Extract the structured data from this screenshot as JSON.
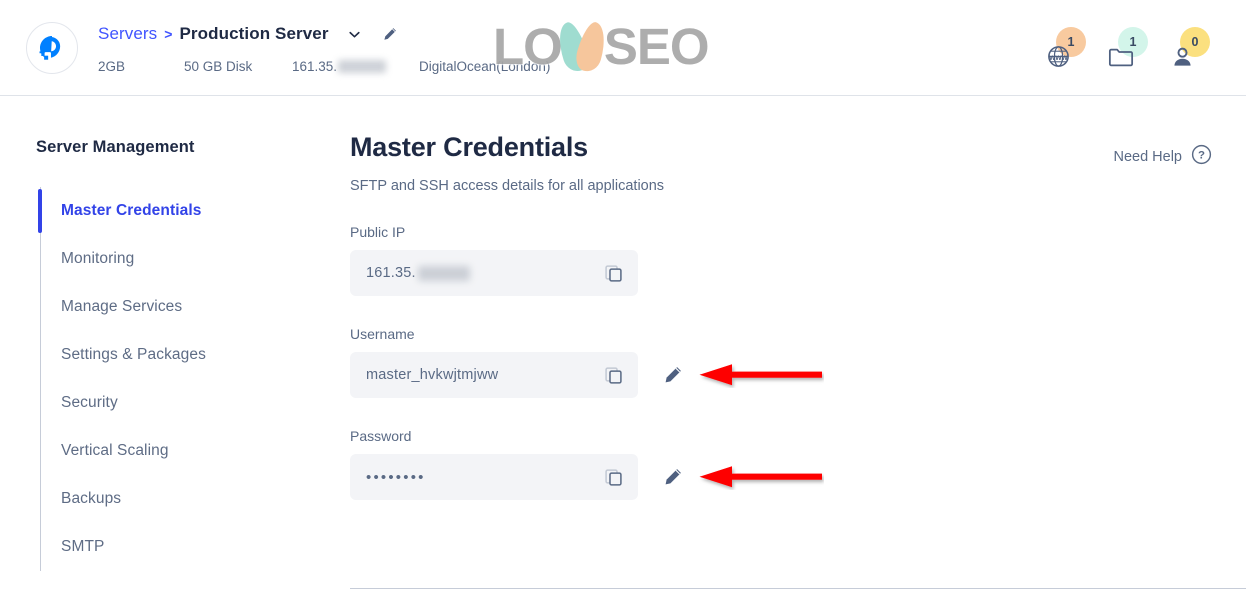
{
  "header": {
    "logo_icon": "digitalocean-logo",
    "breadcrumb": {
      "parent": "Servers",
      "separator": ">",
      "current": "Production Server",
      "chevron_icon": "chevron-down-icon",
      "edit_icon": "pencil-icon"
    },
    "meta": {
      "ram": "2GB",
      "disk": "50 GB Disk",
      "ip": "161.35.",
      "provider": "DigitalOcean(London)"
    },
    "stats": [
      {
        "icon": "www-globe-icon",
        "count": "1",
        "badge_color": "#f8ca9f"
      },
      {
        "icon": "folder-icon",
        "count": "1",
        "badge_color": "#d3f5ea"
      },
      {
        "icon": "user-icon",
        "count": "0",
        "badge_color": "#fbe07f"
      }
    ]
  },
  "watermark": {
    "left_text": "LO",
    "right_text": "SEO",
    "leaf_left_color": "#9fdcd0",
    "leaf_right_color": "#f6c69c"
  },
  "sidebar": {
    "title": "Server Management",
    "items": [
      {
        "label": "Master Credentials",
        "active": true
      },
      {
        "label": "Monitoring",
        "active": false
      },
      {
        "label": "Manage Services",
        "active": false
      },
      {
        "label": "Settings & Packages",
        "active": false
      },
      {
        "label": "Security",
        "active": false
      },
      {
        "label": "Vertical Scaling",
        "active": false
      },
      {
        "label": "Backups",
        "active": false
      },
      {
        "label": "SMTP",
        "active": false
      }
    ],
    "active_color": "#3243e8"
  },
  "main": {
    "title": "Master Credentials",
    "subtitle": "SFTP and SSH access details for all applications",
    "need_help": {
      "label": "Need Help",
      "icon": "question-circle-icon"
    },
    "fields": [
      {
        "label": "Public IP",
        "value": "161.35.",
        "redacted": true,
        "masked": false,
        "copy_icon": "copy-icon",
        "has_edit": false,
        "has_arrow": false
      },
      {
        "label": "Username",
        "value": "master_hvkwjtmjww",
        "redacted": false,
        "masked": false,
        "copy_icon": "copy-icon",
        "has_edit": true,
        "edit_icon": "pencil-icon",
        "has_arrow": true
      },
      {
        "label": "Password",
        "value": "••••••••",
        "redacted": false,
        "masked": true,
        "copy_icon": "copy-icon",
        "has_edit": true,
        "edit_icon": "pencil-icon",
        "has_arrow": true
      }
    ]
  },
  "annotation": {
    "arrow_color": "#fe0000",
    "arrow_direction": "left",
    "count": 2
  }
}
